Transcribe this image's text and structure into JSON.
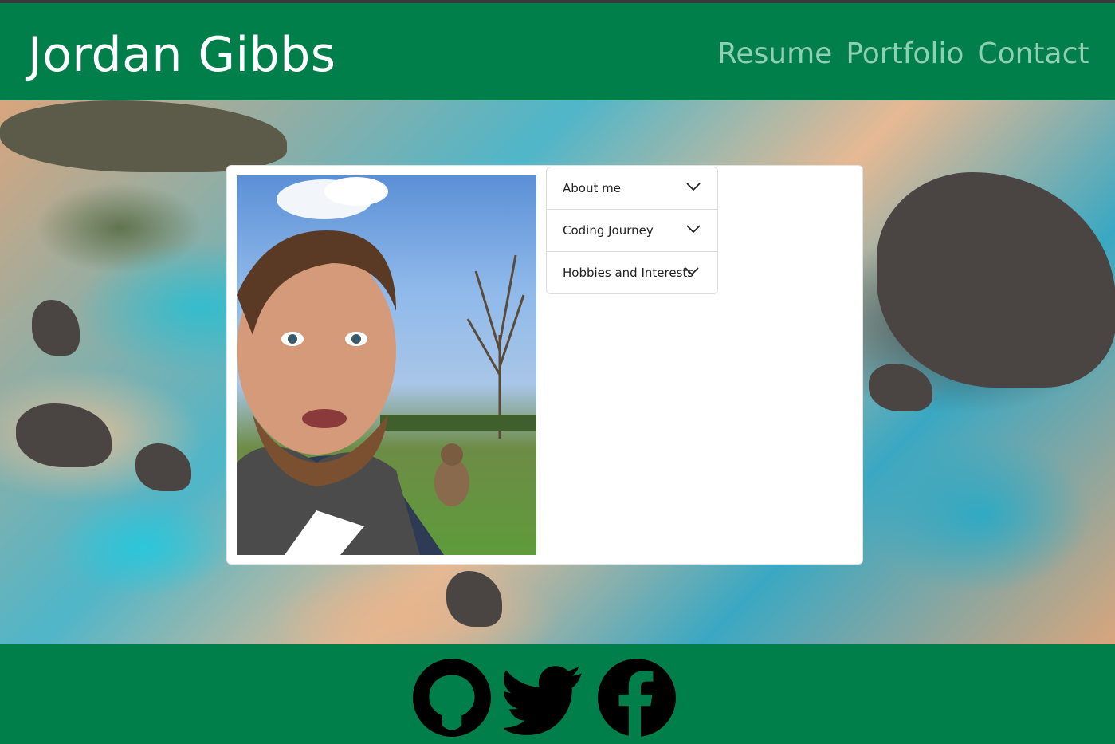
{
  "header": {
    "title": "Jordan Gibbs",
    "nav": [
      "Resume",
      "Portfolio",
      "Contact"
    ]
  },
  "accordion": {
    "items": [
      "About me",
      "Coding Journey",
      "Hobbies and Interests"
    ]
  },
  "footer": {
    "social_icons": [
      "github-icon",
      "twitter-icon",
      "facebook-icon"
    ]
  },
  "colors": {
    "header_bg": "#007f4a",
    "footer_bg": "#007f4a",
    "nav_link": "#8fd0b4",
    "title": "#ffffff"
  }
}
